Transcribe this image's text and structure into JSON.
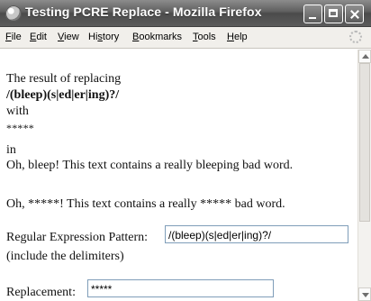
{
  "window": {
    "title": "Testing PCRE Replace - Mozilla Firefox"
  },
  "menubar": {
    "items": [
      {
        "label": "File",
        "mnemonic": "F",
        "rest": "ile"
      },
      {
        "label": "Edit",
        "mnemonic": "E",
        "rest": "dit"
      },
      {
        "label": "View",
        "mnemonic": "V",
        "rest": "iew"
      },
      {
        "label": "History",
        "mnemonic": "s",
        "before": "Hi",
        "rest": "tory"
      },
      {
        "label": "Bookmarks",
        "mnemonic": "B",
        "rest": "ookmarks"
      },
      {
        "label": "Tools",
        "mnemonic": "T",
        "rest": "ools"
      },
      {
        "label": "Help",
        "mnemonic": "H",
        "rest": "elp"
      }
    ]
  },
  "content": {
    "intro_line": "The result of replacing",
    "pattern_display": "/(bleep)(s|ed|er|ing)?/",
    "with_label": "with",
    "replacement_display": "*****",
    "in_label": "in",
    "original_text": "Oh, bleep! This text contains a really bleeping bad word.",
    "result_text": "Oh, *****! This text contains a really ***** bad word.",
    "pattern_label": "Regular Expression Pattern:",
    "pattern_input_value": "/(bleep)(s|ed|er|ing)?/",
    "pattern_hint": "(include the delimiters)",
    "replacement_label": "Replacement:",
    "replacement_input_value": "*****"
  },
  "colors": {
    "titlebar": "#5b5b5b",
    "menubar": "#f1efeb",
    "input_border": "#7f9db9"
  }
}
